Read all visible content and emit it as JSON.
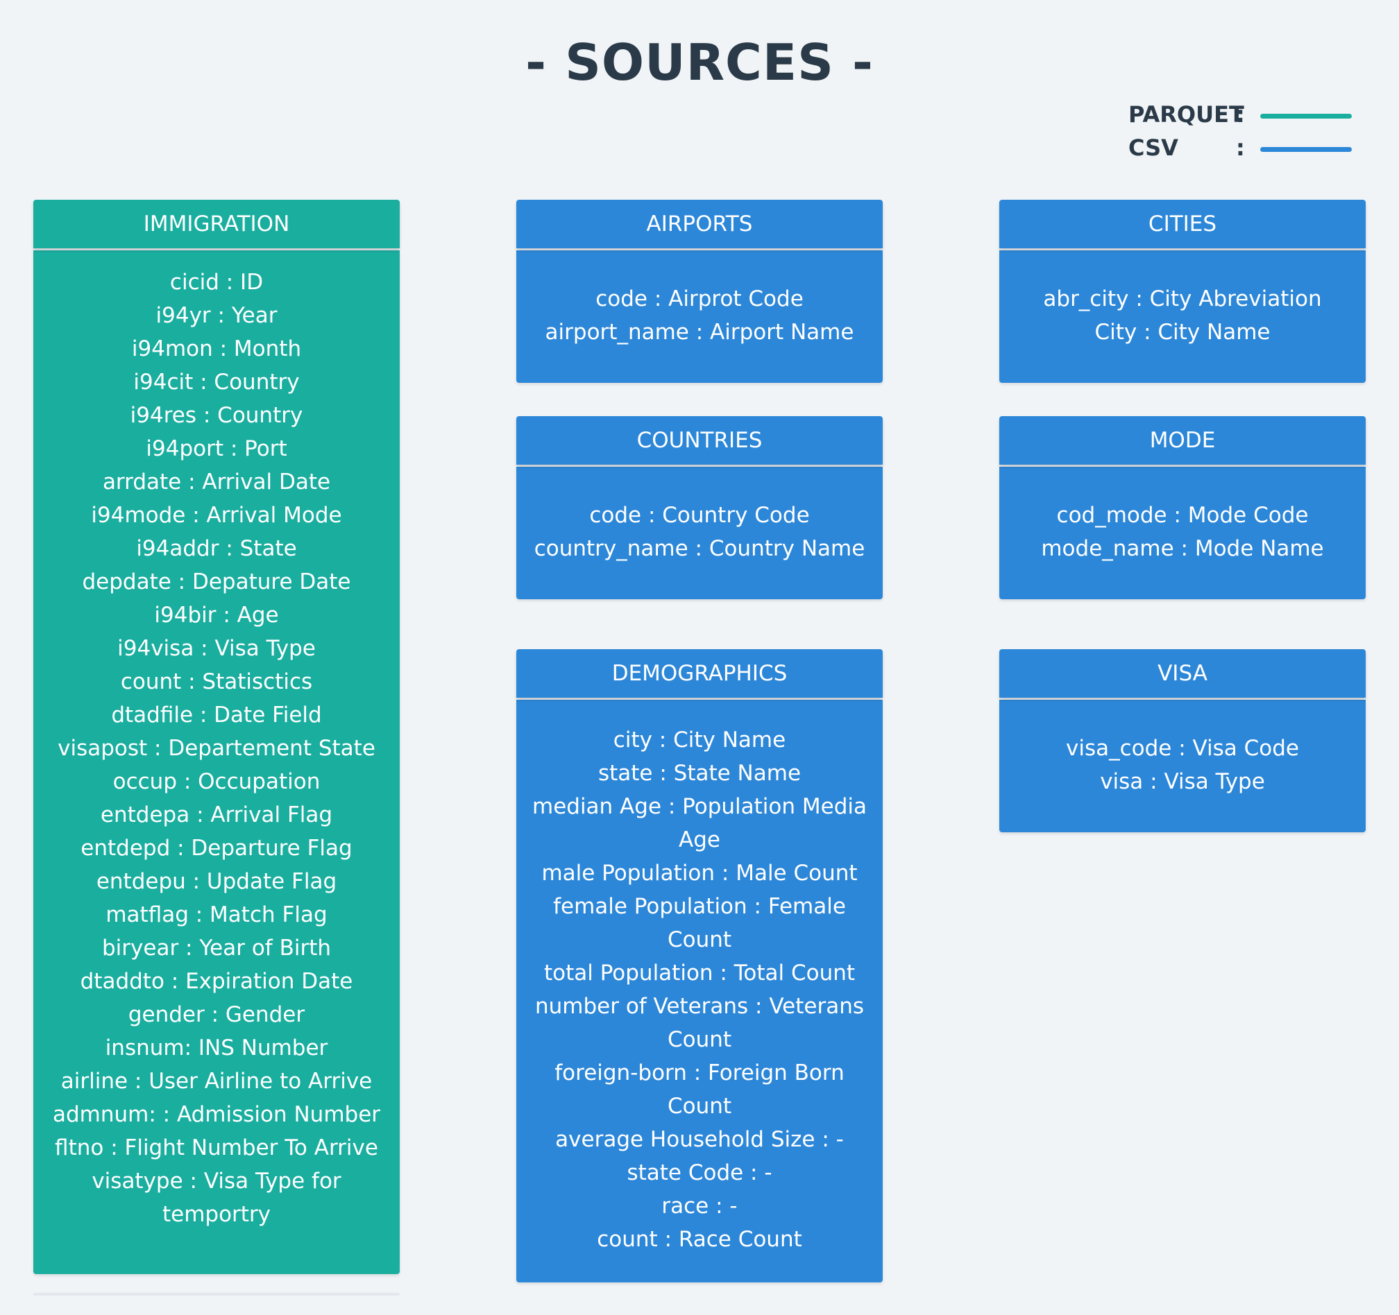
{
  "title": "- SOURCES -",
  "legend": {
    "items": [
      {
        "label": "PARQUET",
        "colon": ":",
        "color": "#1aae9f"
      },
      {
        "label": "CSV",
        "colon": ":",
        "color": "#2d87d8"
      }
    ]
  },
  "entities": {
    "immigration": {
      "name": "IMMIGRATION",
      "format": "parquet",
      "fields": [
        "cicid : ID",
        "i94yr : Year",
        "i94mon : Month",
        "i94cit : Country",
        "i94res : Country",
        "i94port : Port",
        "arrdate : Arrival Date",
        "i94mode : Arrival Mode",
        "i94addr : State",
        "depdate : Depature Date",
        "i94bir : Age",
        "i94visa :  Visa Type",
        "count : Statisctics",
        "dtadfile : Date Field",
        "visapost : Departement State",
        "occup : Occupation",
        "entdepa : Arrival Flag",
        "entdepd : Departure Flag",
        "entdepu : Update Flag",
        "matflag : Match Flag",
        "biryear : Year of Birth",
        "dtaddto : Expiration Date",
        "gender : Gender",
        "insnum: INS Number",
        "airline : User Airline to Arrive",
        "admnum: : Admission Number",
        "fltno : Flight Number To Arrive",
        "visatype : Visa Type for temportry"
      ]
    },
    "airports": {
      "name": "AIRPORTS",
      "format": "csv",
      "fields": [
        "code : Airprot Code",
        "airport_name : Airport Name"
      ]
    },
    "cities": {
      "name": "CITIES",
      "format": "csv",
      "fields": [
        "abr_city : City Abreviation",
        "City : City Name"
      ]
    },
    "countries": {
      "name": "COUNTRIES",
      "format": "csv",
      "fields": [
        "code : Country Code",
        "country_name : Country Name"
      ]
    },
    "mode": {
      "name": "MODE",
      "format": "csv",
      "fields": [
        "cod_mode : Mode Code",
        "mode_name : Mode Name"
      ]
    },
    "demographics": {
      "name": "DEMOGRAPHICS",
      "format": "csv",
      "fields": [
        "city :  City Name",
        "state : State Name",
        "median Age : Population Media Age",
        "male Population :  Male Count",
        "female Population :  Female Count",
        "total Population :  Total Count",
        "number of Veterans :  Veterans Count",
        "foreign-born :  Foreign Born Count",
        "average Household Size :  -",
        "state Code :  -",
        "race :   -",
        "count : Race Count"
      ]
    },
    "visa": {
      "name": "VISA",
      "format": "csv",
      "fields": [
        "visa_code : Visa Code",
        "visa : Visa Type"
      ]
    }
  }
}
